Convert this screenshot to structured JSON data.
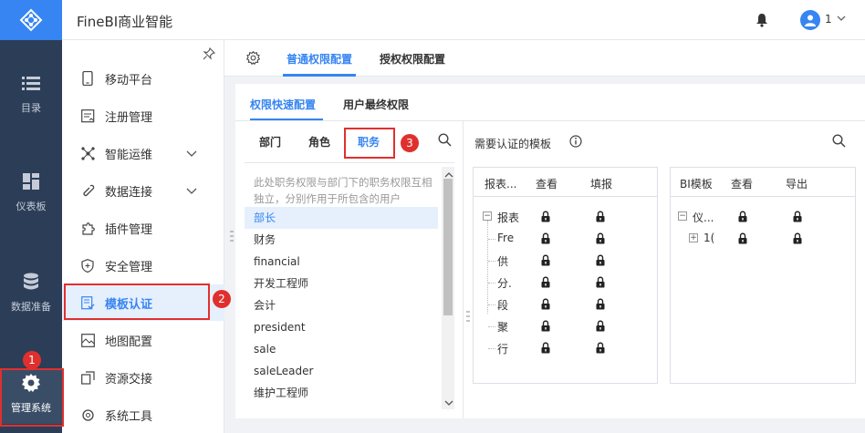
{
  "app": {
    "title": "FineBI商业智能",
    "username": "1"
  },
  "leftnav": [
    {
      "label": "目录",
      "icon": "list-icon"
    },
    {
      "label": "仪表板",
      "icon": "dashboard-icon"
    },
    {
      "label": "数据准备",
      "icon": "database-icon"
    },
    {
      "label": "管理系统",
      "icon": "gear-icon"
    }
  ],
  "submenu": [
    {
      "label": "移动平台",
      "icon": "mobile-icon",
      "has_arrow": false
    },
    {
      "label": "注册管理",
      "icon": "register-icon",
      "has_arrow": false
    },
    {
      "label": "智能运维",
      "icon": "network-icon",
      "has_arrow": true
    },
    {
      "label": "数据连接",
      "icon": "link-icon",
      "has_arrow": true
    },
    {
      "label": "插件管理",
      "icon": "plugin-icon",
      "has_arrow": false
    },
    {
      "label": "安全管理",
      "icon": "shield-icon",
      "has_arrow": false
    },
    {
      "label": "模板认证",
      "icon": "template-icon",
      "has_arrow": false,
      "active": true
    },
    {
      "label": "地图配置",
      "icon": "map-icon",
      "has_arrow": false
    },
    {
      "label": "资源交接",
      "icon": "transfer-icon",
      "has_arrow": false
    },
    {
      "label": "系统工具",
      "icon": "tools-icon",
      "has_arrow": false
    }
  ],
  "badges": [
    "1",
    "2",
    "3"
  ],
  "tabs": {
    "normal": "普通权限配置",
    "grant": "授权权限配置"
  },
  "subtabs": {
    "quick": "权限快速配置",
    "final": "用户最终权限"
  },
  "categories": {
    "dept": "部门",
    "role": "角色",
    "post": "职务"
  },
  "hint": "此处职务权限与部门下的职务权限互相独立，分别作用于所包含的用户",
  "posts": [
    "部长",
    "财务",
    "financial",
    "开发工程师",
    "会计",
    "president",
    "sale",
    "saleLeader",
    "维护工程师"
  ],
  "right": {
    "title": "需要认证的模板"
  },
  "report_table": {
    "headers": [
      "报表...",
      "查看",
      "填报"
    ],
    "root": "报表",
    "children": [
      "Fre",
      "供",
      "分.",
      "段",
      "聚",
      "行"
    ]
  },
  "bi_table": {
    "headers": [
      "BI模板",
      "查看",
      "导出"
    ],
    "root": "仪...",
    "children": [
      "1("
    ]
  },
  "colors": {
    "accent": "#3685f2",
    "nav_bg": "#2c3e57",
    "red": "#e0302e"
  }
}
